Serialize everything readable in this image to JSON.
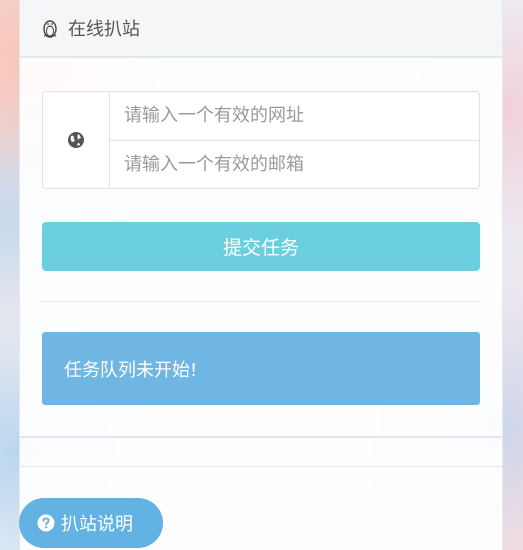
{
  "panel": {
    "title": "在线扒站",
    "title_icon": "penguin-icon"
  },
  "form": {
    "addon_icon": "globe-icon",
    "url_placeholder": "请输入一个有效的网址",
    "email_placeholder": "请输入一个有效的邮箱",
    "submit_label": "提交任务"
  },
  "status": {
    "message": "任务队列未开始!"
  },
  "help": {
    "label": "扒站说明",
    "icon": "question-circle-icon"
  },
  "colors": {
    "submit_button": "#6bcfe0",
    "status_box": "#70b6e2",
    "help_button": "#62b2e4"
  }
}
